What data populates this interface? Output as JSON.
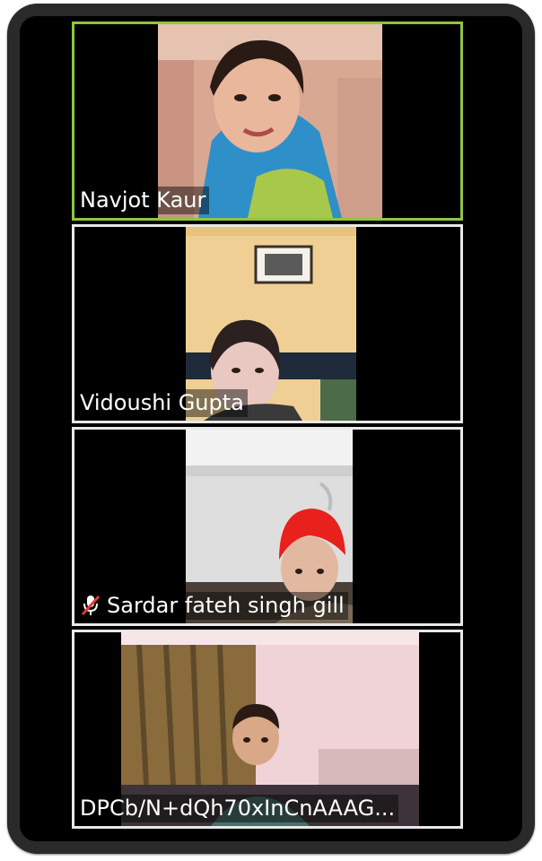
{
  "participants": [
    {
      "name": "Navjot Kaur",
      "active_speaker": true,
      "muted": false
    },
    {
      "name": "Vidoushi Gupta",
      "active_speaker": false,
      "muted": false
    },
    {
      "name": "Sardar fateh singh gill",
      "active_speaker": false,
      "muted": true
    },
    {
      "name": "DPCb/N+dQh70xInCnAAAG...",
      "active_speaker": false,
      "muted": false
    }
  ],
  "colors": {
    "active_speaker_border": "#8ec641",
    "tile_border": "#e8e8e8",
    "background": "#000000",
    "mute_slash": "#e53935"
  },
  "icons": {
    "muted": "microphone-muted-icon"
  }
}
